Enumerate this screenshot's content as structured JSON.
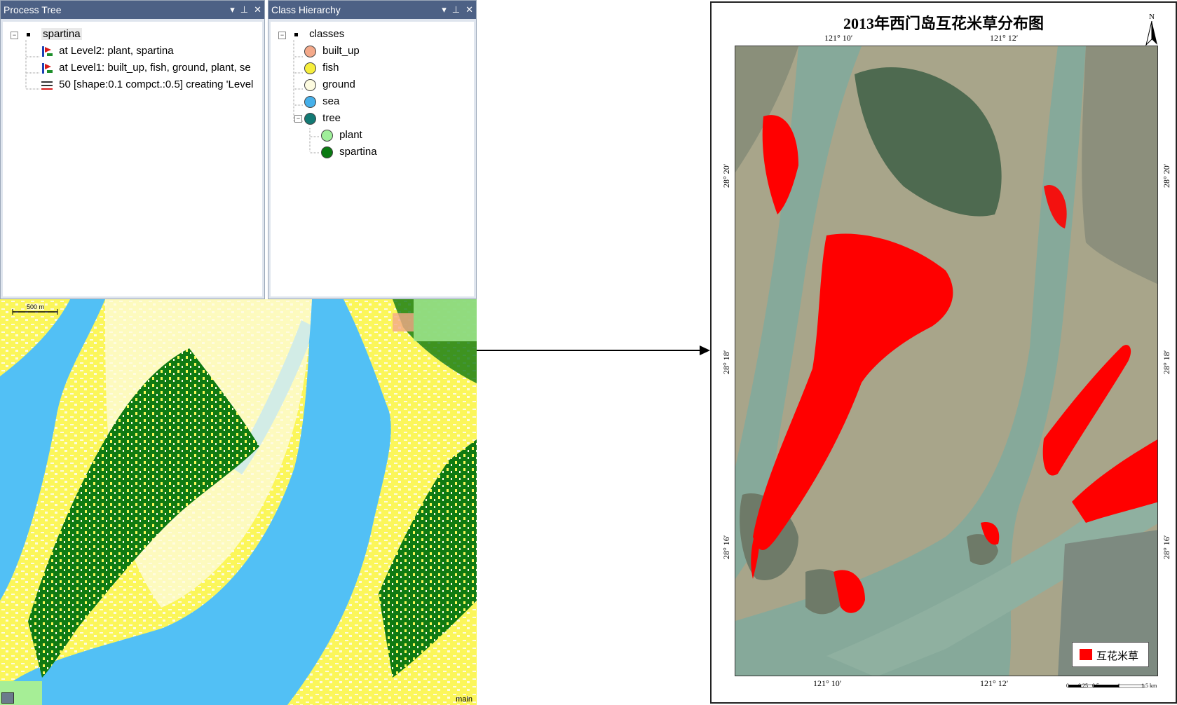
{
  "process_tree": {
    "title": "Process Tree",
    "items": [
      {
        "label": "spartina"
      },
      {
        "label": "at  Level2: plant, spartina"
      },
      {
        "label": "at  Level1: built_up, fish, ground, plant, se"
      },
      {
        "label": "50 [shape:0.1 compct.:0.5] creating 'Level"
      }
    ]
  },
  "class_hierarchy": {
    "title": "Class Hierarchy",
    "items": [
      {
        "label": "classes"
      },
      {
        "label": "built_up",
        "color": "#f4a98a"
      },
      {
        "label": "fish",
        "color": "#f6ee3c"
      },
      {
        "label": "ground",
        "color": "#fdfbe0"
      },
      {
        "label": "sea",
        "color": "#46b0ea"
      },
      {
        "label": "tree",
        "color": "#137a74"
      },
      {
        "label": "plant",
        "color": "#9fef9a"
      },
      {
        "label": "spartina",
        "color": "#0a7a12"
      }
    ]
  },
  "panel_controls": {
    "dropdown": "▾",
    "pin": "⊥",
    "close": "✕"
  },
  "classified_view": {
    "scale_label": "500 m",
    "view_label": "main",
    "colors": {
      "sea": "#52c0f5",
      "ground": "#fdfbe0",
      "fish": "#fbf65a",
      "spartina": "#0f7a12",
      "plant": "#a6ee96",
      "built_up": "#f4a98a"
    }
  },
  "map": {
    "title": "2013年西门岛互花米草分布图",
    "north": "N",
    "top_coords": [
      "121° 10′",
      "121° 12′"
    ],
    "bottom_coords": [
      "121° 10′",
      "121° 12′"
    ],
    "left_coords": [
      "28° 20′",
      "28° 18′",
      "28° 16′"
    ],
    "right_coords": [
      "28° 20′",
      "28° 18′",
      "28° 16′"
    ],
    "legend_label": "互花米草",
    "legend_color": "#ff0000",
    "scale_ticks": [
      "0",
      "0.25",
      "0.5",
      "1",
      "1.5 km"
    ]
  }
}
